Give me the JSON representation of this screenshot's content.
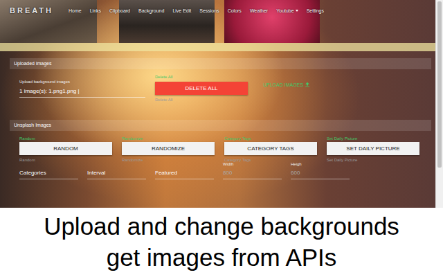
{
  "app": {
    "logo": "BREATH"
  },
  "nav": [
    {
      "label": "Home",
      "dropdown": false
    },
    {
      "label": "Links",
      "dropdown": false
    },
    {
      "label": "Clipboard",
      "dropdown": false
    },
    {
      "label": "Background",
      "dropdown": false
    },
    {
      "label": "Live Edit",
      "dropdown": false
    },
    {
      "label": "Sessions",
      "dropdown": false
    },
    {
      "label": "Colors",
      "dropdown": false
    },
    {
      "label": "Weather",
      "dropdown": false
    },
    {
      "label": "Youtube",
      "dropdown": true
    },
    {
      "label": "Settings",
      "dropdown": false
    }
  ],
  "uploaded": {
    "title": "Uploaded images",
    "upload_label": "Upload background images",
    "field_value": "1 image(s): 1.png1.png |",
    "delete": {
      "hint_above": "Delete All",
      "label": "DELETE ALL",
      "hint_below": "Delete All"
    },
    "upload_link": "UPLOAD IMAGES"
  },
  "unsplash": {
    "title": "Unsplash Images",
    "actions": [
      {
        "label": "Random",
        "button": "RANDOM",
        "hint": "Random"
      },
      {
        "label": "Randomize",
        "button": "RANDOMIZE",
        "hint": "Randomize"
      },
      {
        "label": "Category Tags",
        "button": "CATEGORY TAGS",
        "hint": "Category Tags"
      },
      {
        "label": "Set Daily Picture",
        "button": "SET DAILY PICTURE",
        "hint": "Set Daily Picture"
      }
    ],
    "fields": [
      {
        "kind": "placeholder",
        "label": "",
        "text": "Categories",
        "disabled": false
      },
      {
        "kind": "placeholder",
        "label": "",
        "text": "Interval",
        "disabled": false
      },
      {
        "kind": "placeholder",
        "label": "",
        "text": "Featured",
        "disabled": false
      },
      {
        "kind": "labeled",
        "label": "Width",
        "text": "800",
        "disabled": true
      },
      {
        "kind": "labeled",
        "label": "Heigh",
        "text": "600",
        "disabled": true
      }
    ]
  },
  "caption": [
    "Upload and change backgrounds",
    "get images from APIs"
  ]
}
